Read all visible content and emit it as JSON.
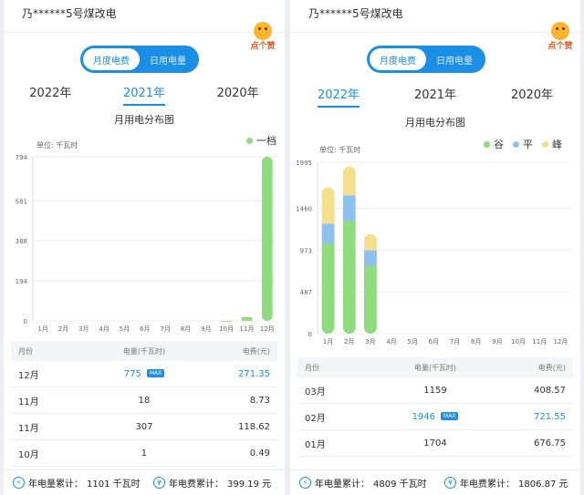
{
  "colors": {
    "accent": "#1b8ee5",
    "valley": "#8fdc7e",
    "flat": "#8ec1ee",
    "peak": "#f3df8c"
  },
  "left": {
    "account": "乃******5号煤改电",
    "mascot": "点个赞",
    "tabs": [
      {
        "label": "月度电费",
        "active": true
      },
      {
        "label": "日用电量",
        "active": false
      }
    ],
    "years": [
      {
        "label": "2022年",
        "active": false
      },
      {
        "label": "2021年",
        "active": true
      },
      {
        "label": "2020年",
        "active": false
      }
    ],
    "chart_title": "月用电分布图",
    "unit": "单位: 千瓦时",
    "legend": [
      {
        "label": "一档",
        "color": "#8fdc7e"
      }
    ],
    "table_headers": {
      "month": "月份",
      "power": "电量(千瓦时)",
      "fee": "电费(元)"
    },
    "rows": [
      {
        "month": "12月",
        "power": "775",
        "fee": "271.35",
        "max": "MAX"
      },
      {
        "month": "11月",
        "power": "18",
        "fee": "8.73"
      },
      {
        "month": "11月",
        "power": "307",
        "fee": "118.62"
      },
      {
        "month": "10月",
        "power": "1",
        "fee": "0.49"
      }
    ],
    "footer": {
      "power_label": "年电量累计：",
      "power_value": "1101 千瓦时",
      "fee_label": "年电费累计：",
      "fee_value": "399.19 元"
    }
  },
  "right": {
    "account": "乃******5号煤改电",
    "mascot": "点个赞",
    "tabs": [
      {
        "label": "月度电费",
        "active": true
      },
      {
        "label": "日用电量",
        "active": false
      }
    ],
    "years": [
      {
        "label": "2022年",
        "active": true
      },
      {
        "label": "2021年",
        "active": false
      },
      {
        "label": "2020年",
        "active": false
      }
    ],
    "chart_title": "月用电分布图",
    "unit": "单位: 千瓦时",
    "legend": [
      {
        "label": "谷",
        "color": "#8fdc7e"
      },
      {
        "label": "平",
        "color": "#8ec1ee"
      },
      {
        "label": "峰",
        "color": "#f3df8c"
      }
    ],
    "table_headers": {
      "month": "月份",
      "power": "电量(千瓦时)",
      "fee": "电费(元)"
    },
    "rows": [
      {
        "month": "03月",
        "power": "1159",
        "fee": "408.57"
      },
      {
        "month": "02月",
        "power": "1946",
        "fee": "721.55",
        "max": "MAX"
      },
      {
        "month": "01月",
        "power": "1704",
        "fee": "676.75"
      }
    ],
    "footer": {
      "power_label": "年电量累计：",
      "power_value": "4809 千瓦时",
      "fee_label": "年电费累计：",
      "fee_value": "1806.87 元"
    }
  },
  "chart_data": [
    {
      "type": "bar",
      "categories": [
        "1月",
        "2月",
        "3月",
        "4月",
        "5月",
        "6月",
        "7月",
        "8月",
        "9月",
        "10月",
        "11月",
        "12月"
      ],
      "yticks": [
        "0",
        "194",
        "388",
        "581",
        "794"
      ],
      "ylim": [
        0,
        794
      ],
      "series": [
        {
          "name": "一档",
          "values": [
            0,
            0,
            0,
            0,
            0,
            0,
            0,
            0,
            0,
            1,
            18,
            794
          ]
        }
      ],
      "ylabel": "单位: 千瓦时"
    },
    {
      "type": "bar",
      "stacked": true,
      "categories": [
        "1月",
        "2月",
        "3月",
        "4月",
        "5月",
        "6月",
        "7月",
        "8月",
        "9月",
        "10月",
        "11月",
        "12月"
      ],
      "yticks": [
        "0",
        "487",
        "973",
        "1460",
        "1995"
      ],
      "ylim": [
        0,
        1995
      ],
      "series": [
        {
          "name": "谷",
          "values": [
            1050,
            1310,
            790,
            0,
            0,
            0,
            0,
            0,
            0,
            0,
            0,
            0
          ]
        },
        {
          "name": "平",
          "values": [
            230,
            300,
            180,
            0,
            0,
            0,
            0,
            0,
            0,
            0,
            0,
            0
          ]
        },
        {
          "name": "峰",
          "values": [
            424,
            336,
            189,
            0,
            0,
            0,
            0,
            0,
            0,
            0,
            0,
            0
          ]
        }
      ],
      "ylabel": "单位: 千瓦时"
    }
  ]
}
